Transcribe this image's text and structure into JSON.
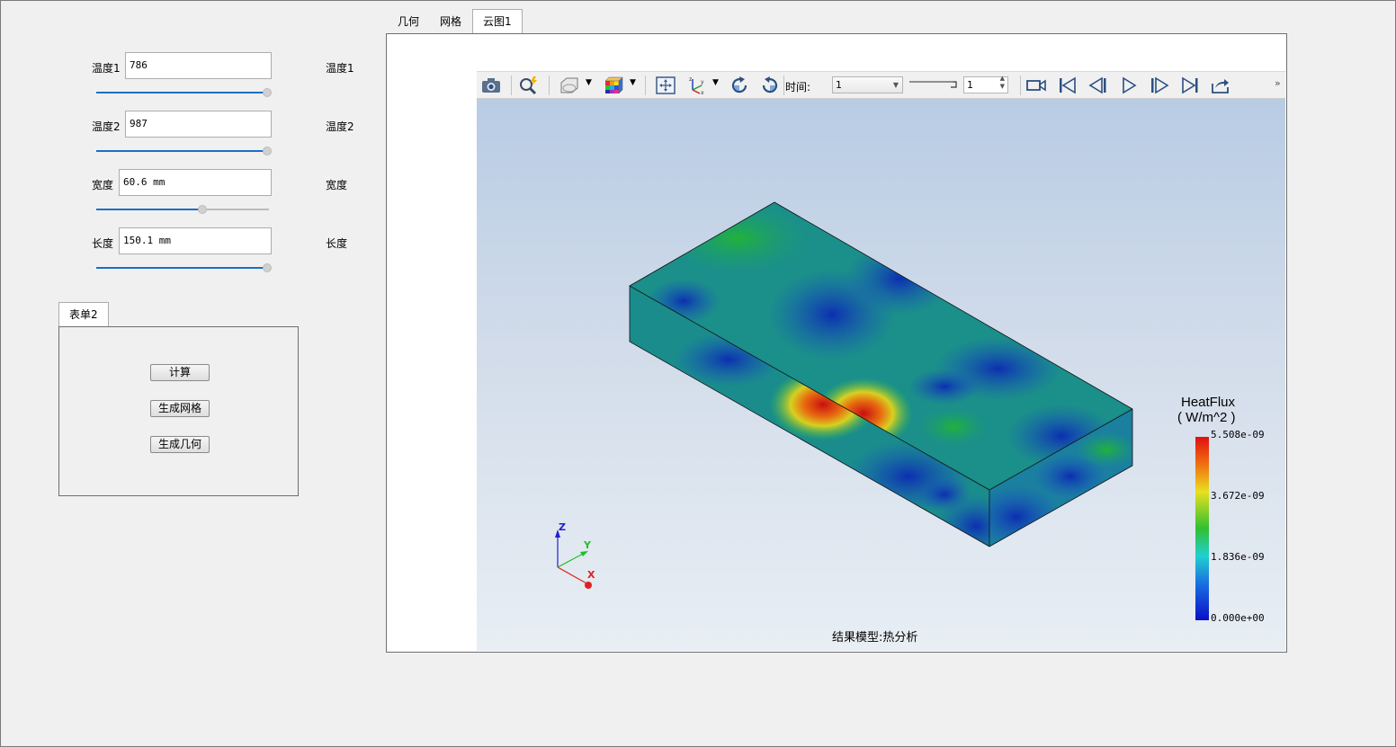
{
  "params": [
    {
      "label": "温度1",
      "value": "786",
      "right_label": "温度1",
      "slider": 1.0
    },
    {
      "label": "温度2",
      "value": "987",
      "right_label": "温度2",
      "slider": 1.0
    },
    {
      "label": "宽度",
      "value": "60.6 mm",
      "right_label": "宽度",
      "slider": 0.62
    },
    {
      "label": "长度",
      "value": "150.1 mm",
      "right_label": "长度",
      "slider": 1.0
    }
  ],
  "form_tab": {
    "label": "表单2"
  },
  "buttons": {
    "compute": "计算",
    "gen_mesh": "生成网格",
    "gen_geom": "生成几何"
  },
  "main_tabs": [
    {
      "label": "几何",
      "active": false
    },
    {
      "label": "网格",
      "active": false
    },
    {
      "label": "云图1",
      "active": true
    }
  ],
  "toolbar": {
    "time_label": "时间:",
    "time_select": "1",
    "time_spin": "1",
    "icons": [
      "camera-icon",
      "zoom-icon",
      "clip-icon",
      "color-cube-icon",
      "fit-view-icon",
      "axis-icon",
      "rotate-cw-icon",
      "rotate-ccw-icon",
      "record-icon",
      "first-frame-icon",
      "prev-frame-icon",
      "play-icon",
      "next-frame-icon",
      "last-frame-icon",
      "export-icon"
    ]
  },
  "legend": {
    "title": "HeatFlux",
    "unit": "( W/m^2 )",
    "max": "5.508e-09",
    "mid_high": "3.672e-09",
    "mid_low": "1.836e-09",
    "min": "0.000e+00"
  },
  "axes": {
    "x": "X",
    "y": "Y",
    "z": "Z"
  },
  "footer": "结果模型:热分析",
  "colors": {
    "accent": "#1c6fc4",
    "axis_x": "#e02020",
    "axis_y": "#20c020",
    "axis_z": "#2020d0"
  }
}
